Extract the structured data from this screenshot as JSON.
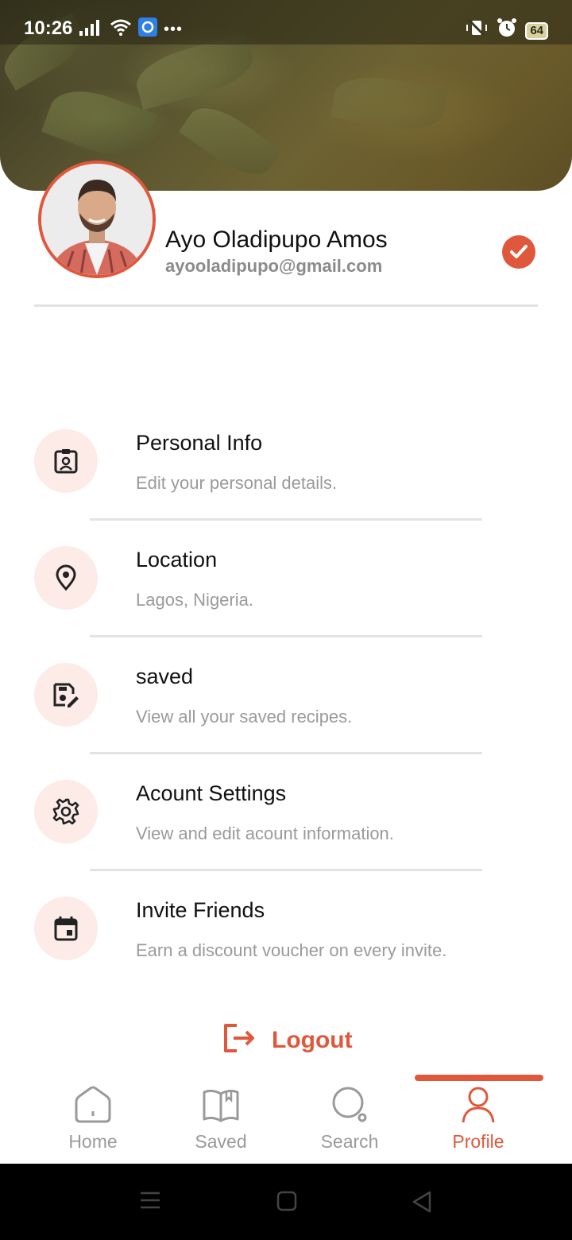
{
  "status_bar": {
    "time": "10:26",
    "battery": "64"
  },
  "profile": {
    "name": "Ayo Oladipupo Amos",
    "email": "ayooladipupo@gmail.com"
  },
  "menu": {
    "items": [
      {
        "title": "Personal Info",
        "subtitle": "Edit your personal details.",
        "icon": "id-badge-icon"
      },
      {
        "title": "Location",
        "subtitle": "Lagos, Nigeria.",
        "icon": "location-pin-icon"
      },
      {
        "title": "saved",
        "subtitle": "View all your saved recipes.",
        "icon": "save-edit-icon"
      },
      {
        "title": "Acount Settings",
        "subtitle": "View and edit acount information.",
        "icon": "gear-icon"
      },
      {
        "title": "Invite Friends",
        "subtitle": "Earn a discount voucher on every invite.",
        "icon": "calendar-icon"
      }
    ]
  },
  "logout": {
    "label": "Logout"
  },
  "bottom_nav": {
    "items": [
      {
        "label": "Home",
        "icon": "home-icon"
      },
      {
        "label": "Saved",
        "icon": "book-icon"
      },
      {
        "label": "Search",
        "icon": "search-icon"
      },
      {
        "label": "Profile",
        "icon": "user-icon"
      }
    ],
    "active": "Profile"
  },
  "colors": {
    "accent": "#e0583c",
    "icon_bg": "#fcebe7",
    "muted_text": "#9a9a9a"
  }
}
